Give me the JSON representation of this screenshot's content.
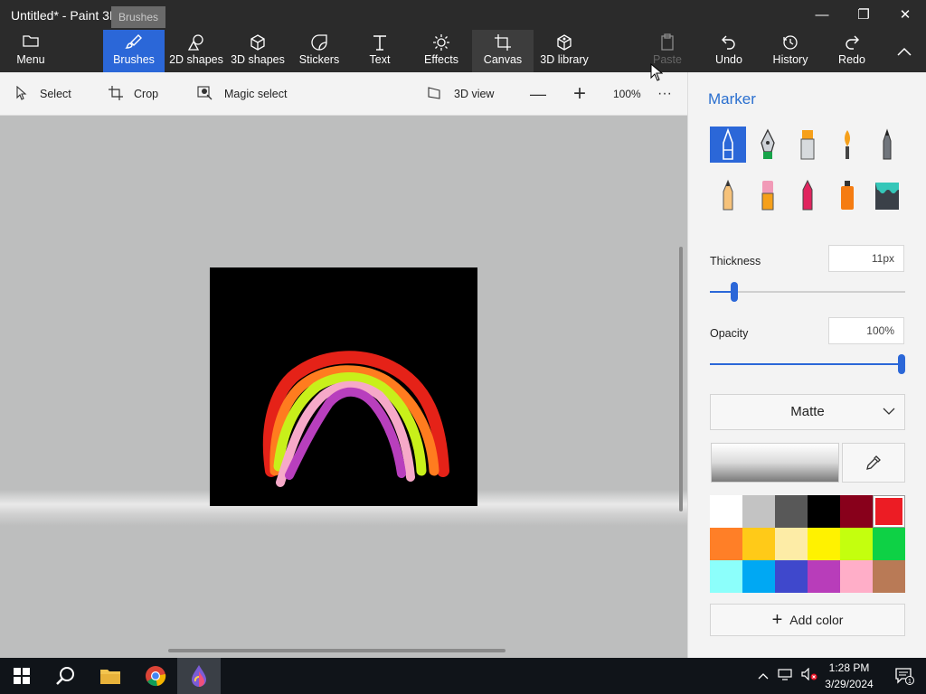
{
  "window": {
    "title": "Untitled* - Paint 3D",
    "tooltip": "Brushes"
  },
  "window_controls": {
    "minimize": "—",
    "restore": "❐",
    "close": "✕"
  },
  "ribbon": {
    "menu": "Menu",
    "brushes": "Brushes",
    "shapes2d": "2D shapes",
    "shapes3d": "3D shapes",
    "stickers": "Stickers",
    "text": "Text",
    "effects": "Effects",
    "canvas": "Canvas",
    "library3d": "3D library",
    "paste": "Paste",
    "undo": "Undo",
    "history": "History",
    "redo": "Redo"
  },
  "toolbar": {
    "select": "Select",
    "crop": "Crop",
    "magic_select": "Magic select",
    "view3d": "3D view",
    "zoom_out": "—",
    "zoom_in": "+",
    "zoom_level": "100%",
    "more": "···"
  },
  "panel": {
    "title": "Marker",
    "brushes": [
      "marker",
      "calligraphy-pen",
      "oil-brush",
      "watercolor",
      "pixel-pen",
      "pencil",
      "eraser",
      "crayon",
      "spray-can",
      "fill"
    ],
    "thickness_label": "Thickness",
    "thickness_value": "11px",
    "thickness_level": 0.11,
    "opacity_label": "Opacity",
    "opacity_value": "100%",
    "opacity_level": 1.0,
    "finish": "Matte",
    "add_color": "Add color",
    "accent": "#2b67d8"
  },
  "palette": [
    "#ffffff",
    "#c3c3c3",
    "#585858",
    "#000000",
    "#88001b",
    "#ec1c24",
    "#ff7f27",
    "#ffca18",
    "#fdeca6",
    "#fff200",
    "#c4ff0e",
    "#0ed145",
    "#8cfffb",
    "#00a8f3",
    "#3f48cc",
    "#b83dba",
    "#ffaec8",
    "#b97a56"
  ],
  "selected_color": "#ec1c24",
  "taskbar": {
    "time": "1:28 PM",
    "date": "3/29/2024",
    "notifications": "1"
  }
}
